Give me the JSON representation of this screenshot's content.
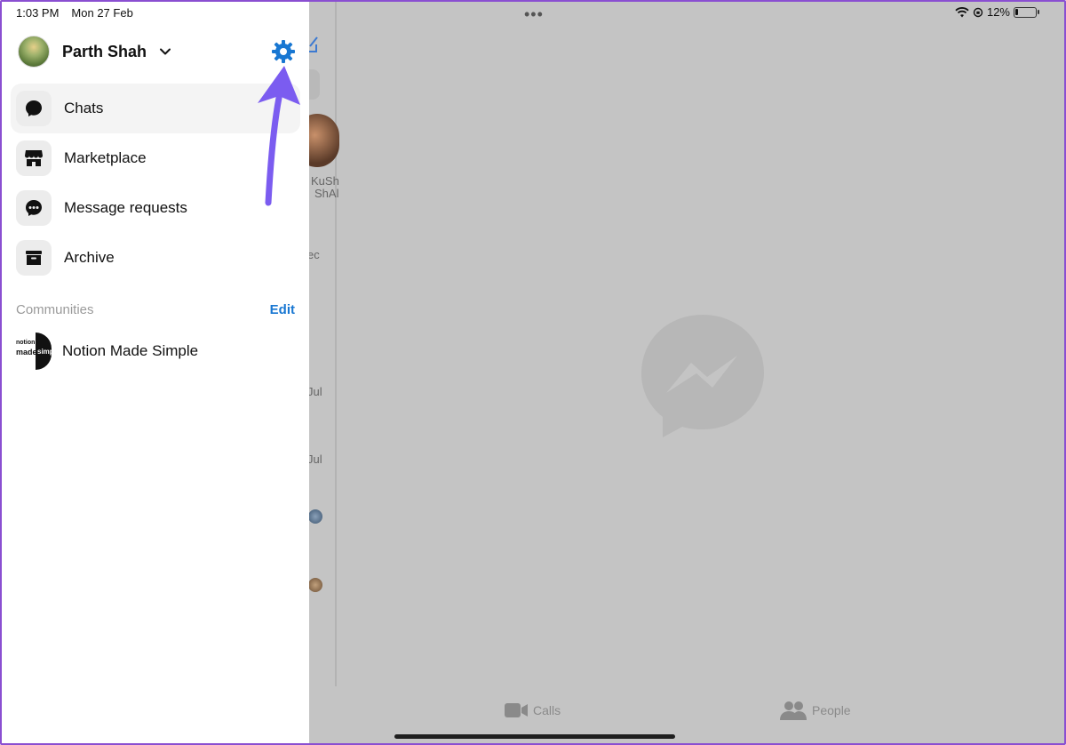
{
  "status_bar": {
    "time": "1:03 PM",
    "date": "Mon 27 Feb",
    "battery": "12%",
    "icons": [
      "wifi-icon",
      "orientation-lock-icon",
      "battery-icon"
    ]
  },
  "profile": {
    "name": "Parth Shah",
    "icons": [
      "avatar",
      "chevron-down-icon",
      "gear-icon"
    ]
  },
  "menu": {
    "items": [
      {
        "label": "Chats",
        "icon": "chat-bubble-icon",
        "active": true
      },
      {
        "label": "Marketplace",
        "icon": "storefront-icon",
        "active": false
      },
      {
        "label": "Message requests",
        "icon": "message-requests-icon",
        "active": false
      },
      {
        "label": "Archive",
        "icon": "archive-box-icon",
        "active": false
      }
    ]
  },
  "communities": {
    "title": "Communities",
    "edit_label": "Edit",
    "items": [
      {
        "name": "Notion Made Simple",
        "logo_text": [
          "notion",
          "made",
          "simp"
        ]
      }
    ]
  },
  "background": {
    "contact_name_line1": "KuSh",
    "contact_name_line2": "ShAl",
    "date_fragments": [
      "ec",
      "Jul",
      "Jul"
    ]
  },
  "tabbar": {
    "calls_label": "Calls",
    "people_label": "People"
  },
  "colors": {
    "accent": "#1877d2",
    "arrow": "#7b5cf0",
    "overlay": "#c4c4c4"
  }
}
